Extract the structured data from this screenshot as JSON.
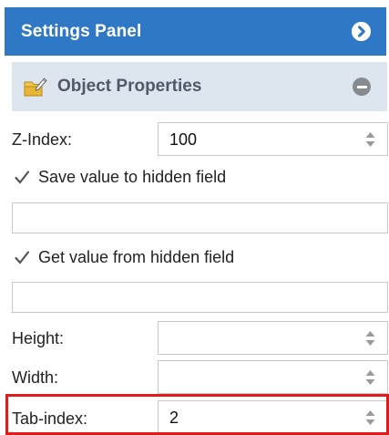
{
  "header": {
    "title": "Settings Panel",
    "collapse_icon": "chevron-right-circle-icon",
    "color": "#2f78c5"
  },
  "section": {
    "title": "Object Properties",
    "icon": "folder-edit-icon",
    "toggle_icon": "minus-circle-icon",
    "color": "#dde5ef"
  },
  "fields": {
    "z_index": {
      "label": "Z-Index:",
      "value": "100"
    },
    "save_hidden": {
      "label": "Save value to hidden field",
      "checked": true,
      "input_value": ""
    },
    "get_hidden": {
      "label": "Get value from hidden field",
      "checked": true,
      "input_value": ""
    },
    "height": {
      "label": "Height:",
      "value": ""
    },
    "width": {
      "label": "Width:",
      "value": ""
    },
    "tab_index": {
      "label": "Tab-index:",
      "value": "2"
    }
  },
  "highlight": {
    "target": "tab-index",
    "color": "#e01b1b"
  }
}
